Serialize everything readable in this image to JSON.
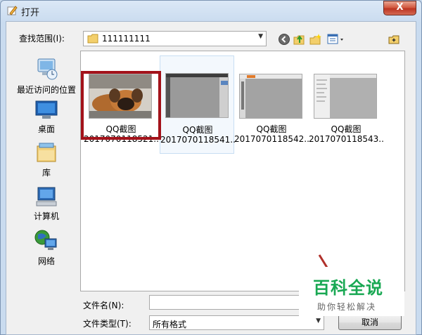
{
  "window": {
    "title": "打开",
    "close_glyph": "X"
  },
  "toolbar": {
    "look_in_label": "查找范围(I):",
    "look_in_value": "111111111",
    "icons": [
      "back-icon",
      "up-folder-icon",
      "new-folder-icon",
      "views-menu-icon",
      "folder-corner-icon"
    ]
  },
  "places": [
    {
      "label": "最近访问的位置",
      "icon": "recent-places-icon"
    },
    {
      "label": "桌面",
      "icon": "desktop-icon"
    },
    {
      "label": "库",
      "icon": "libraries-icon"
    },
    {
      "label": "计算机",
      "icon": "computer-icon"
    },
    {
      "label": "网络",
      "icon": "network-icon"
    }
  ],
  "files": [
    {
      "name": "QQ截图",
      "sub": "2017070118521...",
      "thumb": "dog-photo"
    },
    {
      "name": "QQ截图",
      "sub": "2017070118541...",
      "thumb": "screenshot"
    },
    {
      "name": "QQ截图",
      "sub": "2017070118542...",
      "thumb": "screenshot"
    },
    {
      "name": "QQ截图",
      "sub": "2017070118543...",
      "thumb": "screenshot"
    }
  ],
  "footer": {
    "filename_label": "文件名(N):",
    "filename_value": "",
    "filetype_label": "文件类型(T):",
    "filetype_value": "所有格式",
    "cancel_label": "取消"
  },
  "watermark": {
    "title": "百科全说",
    "subtitle": "助你轻松解决"
  },
  "colors": {
    "highlight": "#a3121a",
    "watermark_green": "#19a853"
  }
}
